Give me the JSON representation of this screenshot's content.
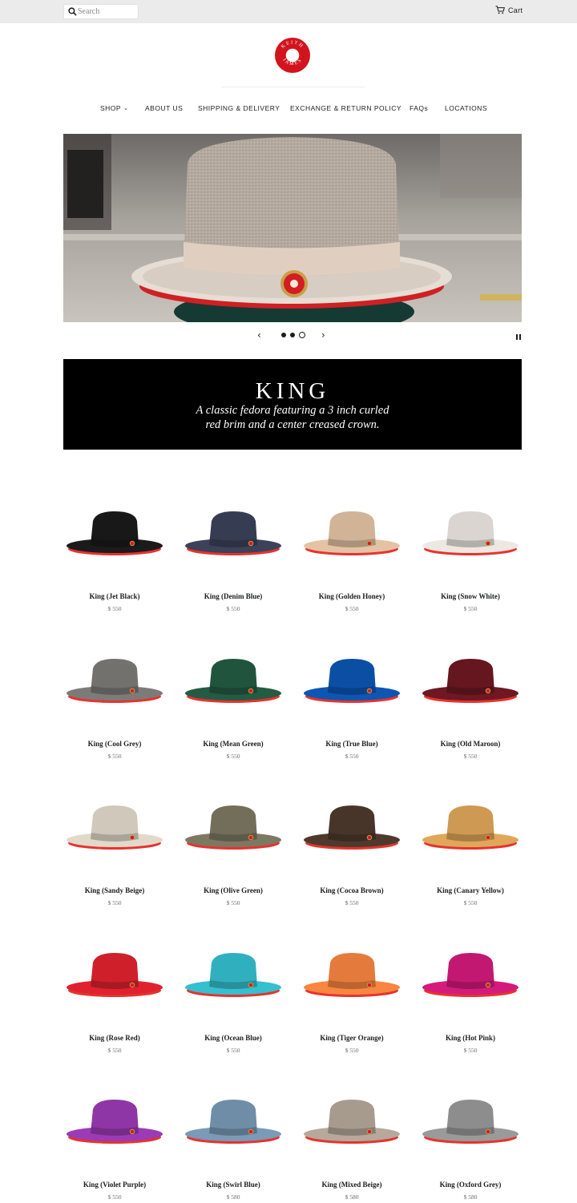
{
  "header": {
    "search_placeholder": "Search",
    "cart_label": "Cart"
  },
  "logo": {
    "text": "KEITH JAMES",
    "color": "#d3141d"
  },
  "nav": {
    "items": [
      {
        "label": "SHOP",
        "has_dropdown": true
      },
      {
        "label": "ABOUT US"
      },
      {
        "label": "SHIPPING & DELIVERY"
      },
      {
        "label": "EXCHANGE & RETURN POLICY"
      },
      {
        "label": "FAQs"
      },
      {
        "label": "LOCATIONS"
      }
    ]
  },
  "slider": {
    "slide_count": 3,
    "active_slide": 3,
    "prev_icon": "chevron-left-icon",
    "next_icon": "chevron-right-icon",
    "pause_icon": "pause-icon"
  },
  "banner": {
    "title": "KING",
    "subtitle_line1": "A classic fedora featuring a 3 inch curled",
    "subtitle_line2": "red brim and a center creased crown."
  },
  "products": [
    {
      "name": "King (Jet Black)",
      "price": "$ 550",
      "color": "#1b1b1b"
    },
    {
      "name": "King (Denim Blue)",
      "price": "$ 550",
      "color": "#3b4259"
    },
    {
      "name": "King (Golden Honey)",
      "price": "$ 550",
      "color": "#e3c3a4"
    },
    {
      "name": "King (Snow White)",
      "price": "$ 550",
      "color": "#ede8e2"
    },
    {
      "name": "King (Cool Grey)",
      "price": "$ 550",
      "color": "#7d7b78"
    },
    {
      "name": "King (Mean Green)",
      "price": "$ 550",
      "color": "#245c43"
    },
    {
      "name": "King (True Blue)",
      "price": "$ 550",
      "color": "#0d56b3"
    },
    {
      "name": "King (Old Maroon)",
      "price": "$ 550",
      "color": "#6e1822"
    },
    {
      "name": "King (Sandy Beige)",
      "price": "$ 550",
      "color": "#e2d9cb"
    },
    {
      "name": "King (Olive Green)",
      "price": "$ 550",
      "color": "#7d7862"
    },
    {
      "name": "King (Cocoa Brown)",
      "price": "$ 550",
      "color": "#4e3a2d"
    },
    {
      "name": "King (Canary Yellow)",
      "price": "$ 550",
      "color": "#e0a75a"
    },
    {
      "name": "King (Rose Red)",
      "price": "$ 550",
      "color": "#e0222f"
    },
    {
      "name": "King (Ocean Blue)",
      "price": "$ 550",
      "color": "#35bfcf"
    },
    {
      "name": "King (Tiger Orange)",
      "price": "$ 550",
      "color": "#f88540"
    },
    {
      "name": "King (Hot Pink)",
      "price": "$ 550",
      "color": "#d41b7c"
    },
    {
      "name": "King (Violet Purple)",
      "price": "$ 550",
      "color": "#9b3bb5"
    },
    {
      "name": "King (Swirl Blue)",
      "price": "$ 580",
      "color": "#7a9ab7"
    },
    {
      "name": "King (Mixed Beige)",
      "price": "$ 580",
      "color": "#b6a99b"
    },
    {
      "name": "King (Oxford Grey)",
      "price": "$ 580",
      "color": "#9a9a9a"
    }
  ],
  "accent_red": "#e8322d"
}
